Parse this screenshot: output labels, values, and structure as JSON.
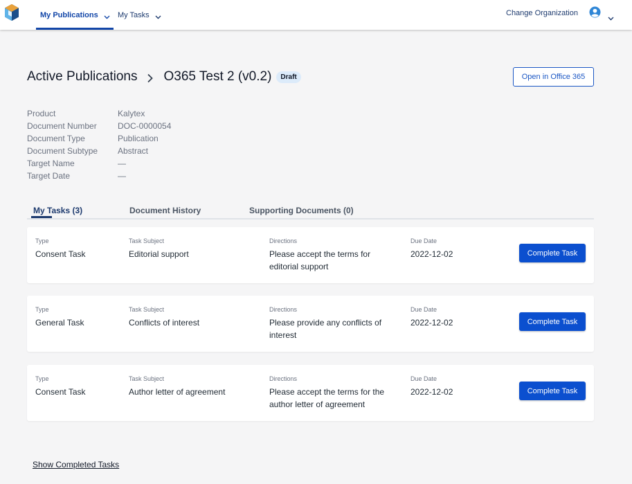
{
  "nav": {
    "items": [
      {
        "label": "My Publications",
        "active": true
      },
      {
        "label": "My Tasks",
        "active": false
      }
    ],
    "change_org_label": "Change Organization"
  },
  "header": {
    "breadcrumb_root": "Active Publications",
    "document_title": "O365 Test 2 (v0.2)",
    "status_badge": "Draft",
    "open_button_label": "Open in Office 365"
  },
  "metadata": [
    {
      "label": "Product",
      "value": "Kalytex"
    },
    {
      "label": "Document Number",
      "value": "DOC-0000054"
    },
    {
      "label": "Document Type",
      "value": "Publication"
    },
    {
      "label": "Document Subtype",
      "value": "Abstract"
    },
    {
      "label": "Target Name",
      "value": "—"
    },
    {
      "label": "Target Date",
      "value": "—"
    }
  ],
  "tabs": [
    {
      "label": "My Tasks (3)",
      "active": true
    },
    {
      "label": "Document History",
      "active": false
    },
    {
      "label": "Supporting Documents (0)",
      "active": false
    }
  ],
  "task_columns": {
    "type": "Type",
    "subject": "Task Subject",
    "directions": "Directions",
    "due": "Due Date"
  },
  "tasks": [
    {
      "type": "Consent Task",
      "subject": "Editorial support",
      "directions": "Please accept the terms for editorial support",
      "due": "2022-12-02",
      "button": "Complete Task"
    },
    {
      "type": "General Task",
      "subject": "Conflicts of interest",
      "directions": "Please provide any conflicts of interest",
      "due": "2022-12-02",
      "button": "Complete Task"
    },
    {
      "type": "Consent Task",
      "subject": "Author letter of agreement",
      "directions": "Please accept the terms for the author letter of agreement",
      "due": "2022-12-02",
      "button": "Complete Task"
    }
  ],
  "footer": {
    "show_completed_label": "Show Completed Tasks"
  },
  "colors": {
    "primary": "#0b4fcf",
    "nav_text": "#1d3a6e",
    "badge_bg": "#dcebfa",
    "page_bg": "#f5f5f6"
  },
  "icons": {
    "logo": "cube-logo-icon",
    "user": "user-avatar-icon",
    "chevron": "chevron-down-icon",
    "breadcrumb_separator": "chevron-right-icon"
  }
}
